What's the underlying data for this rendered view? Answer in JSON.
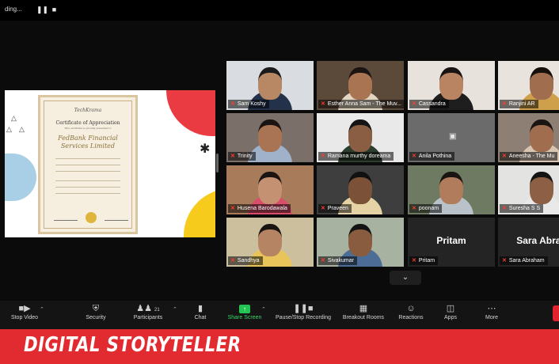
{
  "recording": {
    "status": "ding..."
  },
  "shared_screen": {
    "certificate": {
      "logo": "TechKrama",
      "title": "Certificate of Appreciation",
      "subtitle": "This certificate is proudly presented to",
      "organization": "FedBank Financial Services Limited"
    }
  },
  "participants": [
    {
      "name": "Sam Koshy",
      "muted": true,
      "video": true,
      "bg": "#d9dde2",
      "skin": "#b88763",
      "hair": "#1b1b1b",
      "shirt": "#23324a"
    },
    {
      "name": "Esther Anna Sam - The Muv...",
      "muted": true,
      "video": true,
      "active": true,
      "bg": "#5b4a3a",
      "skin": "#a87452",
      "hair": "#1a1412",
      "shirt": "#e2d6c2"
    },
    {
      "name": "Cassandra",
      "muted": true,
      "video": true,
      "bg": "#e7e2db",
      "skin": "#b98461",
      "hair": "#1a1412",
      "shirt": "#1e1e1e"
    },
    {
      "name": "Ranjini AR",
      "muted": true,
      "video": true,
      "bg": "#e8e3dd",
      "skin": "#a06d4e",
      "hair": "#160f0c",
      "shirt": "#cfa04b"
    },
    {
      "name": "Trinity",
      "muted": true,
      "video": true,
      "bg": "#7b6f6a",
      "skin": "#a87454",
      "hair": "#1a1311",
      "shirt": "#9fb2c9"
    },
    {
      "name": "Ramana murthy doreama",
      "muted": true,
      "video": true,
      "bg": "#e9e9e9",
      "skin": "#8a5e42",
      "hair": "#151515",
      "shirt": "#2d3d2e"
    },
    {
      "name": "Anila Pothina",
      "muted": true,
      "video": false,
      "bg": "#6b6b6b"
    },
    {
      "name": "Aneesha - The Mu",
      "muted": true,
      "video": true,
      "bg": "#8d7f74",
      "skin": "#a06d4e",
      "hair": "#1a1412",
      "shirt": "#d8c6b3"
    },
    {
      "name": "Husena Barodawala",
      "muted": true,
      "video": true,
      "bg": "#a87c5a",
      "skin": "#c49272",
      "hair": "#1a1412",
      "shirt": "#d94d6a"
    },
    {
      "name": "Praveen",
      "muted": true,
      "video": true,
      "bg": "#3e3e3e",
      "skin": "#7b5238",
      "hair": "#111111",
      "shirt": "#e5d3a6"
    },
    {
      "name": "poonam",
      "muted": true,
      "video": true,
      "bg": "#6f7a62",
      "skin": "#b07c5c",
      "hair": "#1a1412",
      "shirt": "#b9c2c9"
    },
    {
      "name": "Suresha S S",
      "muted": true,
      "video": true,
      "bg": "#e3e3e1",
      "skin": "#8d6045",
      "hair": "#141414",
      "shirt": "#e9e9e9"
    },
    {
      "name": "Sandhya",
      "muted": true,
      "video": true,
      "bg": "#cbbf9e",
      "skin": "#b58463",
      "hair": "#1a1412",
      "shirt": "#e8c45a"
    },
    {
      "name": "Sivakumar",
      "muted": true,
      "video": true,
      "bg": "#a8b2a1",
      "skin": "#8a5c3f",
      "hair": "#141414",
      "shirt": "#4c6d95"
    },
    {
      "name": "Pritam",
      "display_name": "Pritam",
      "muted": true,
      "video": false,
      "bg": "#242424"
    },
    {
      "name": "Sara Abraham",
      "display_name": "Sara Abrah",
      "muted": true,
      "video": false,
      "bg": "#242424"
    }
  ],
  "toolbar": {
    "stop_video": "Stop Video",
    "security": "Security",
    "participants": "Participants",
    "participant_count": "21",
    "chat": "Chat",
    "share_screen": "Share Screen",
    "stop_recording": "Pause/Stop Recording",
    "breakout_rooms": "Breakout Rooms",
    "reactions": "Reactions",
    "apps": "Apps",
    "more": "More"
  },
  "banner": {
    "text": "DIGITAL STORYTELLER"
  },
  "colors": {
    "banner": "#e22b30",
    "active_speaker": "#c6ed3c",
    "share_green": "#23c552",
    "mute_red": "#ff3b30"
  },
  "icons": {
    "stop_video": "video-camera-icon",
    "security": "shield-icon",
    "participants": "people-icon",
    "chat": "speech-bubble-icon",
    "share_screen": "share-arrow-icon",
    "stop_recording": "pause-stop-icon",
    "breakout_rooms": "grid-rooms-icon",
    "reactions": "smiley-icon",
    "apps": "apps-icon",
    "more": "ellipsis-icon"
  }
}
